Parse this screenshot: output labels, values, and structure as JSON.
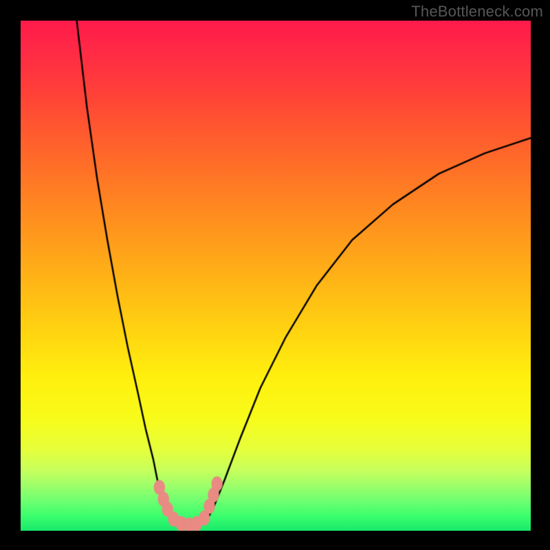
{
  "watermark": {
    "text": "TheBottleneck.com"
  },
  "colors": {
    "background": "#000000",
    "curve_stroke": "#000000",
    "marker_fill": "#e98a83",
    "gradient_stops": [
      "#ff1a4a",
      "#ff5a2e",
      "#ffa519",
      "#fff00e",
      "#c8ff5a",
      "#18e86a"
    ]
  },
  "chart_data": {
    "type": "line",
    "title": "",
    "xlabel": "",
    "ylabel": "",
    "xlim": [
      0,
      100
    ],
    "ylim": [
      0,
      100
    ],
    "grid": false,
    "series": [
      {
        "name": "left-branch",
        "x": [
          11,
          13,
          15,
          17,
          19,
          21,
          23,
          24.5,
          26,
          27,
          28.5,
          30
        ],
        "y": [
          100,
          83,
          69,
          57,
          46,
          36,
          27,
          20,
          14,
          9,
          5,
          2
        ]
      },
      {
        "name": "valley-floor",
        "x": [
          30,
          31,
          32,
          33,
          34,
          35,
          36.5
        ],
        "y": [
          2,
          1.3,
          1.0,
          0.9,
          1.0,
          1.3,
          2
        ]
      },
      {
        "name": "right-branch",
        "x": [
          36.5,
          38,
          40,
          43,
          47,
          52,
          58,
          65,
          73,
          82,
          91,
          100
        ],
        "y": [
          2,
          5,
          10,
          18,
          28,
          38,
          48,
          57,
          64,
          70,
          74,
          77
        ]
      }
    ],
    "markers": {
      "name": "valley-markers",
      "points": [
        {
          "x": 27.2,
          "y": 8.5
        },
        {
          "x": 28.0,
          "y": 6.2
        },
        {
          "x": 28.8,
          "y": 4.2
        },
        {
          "x": 30.0,
          "y": 2.3
        },
        {
          "x": 31.5,
          "y": 1.4
        },
        {
          "x": 33.0,
          "y": 1.1
        },
        {
          "x": 34.5,
          "y": 1.4
        },
        {
          "x": 36.0,
          "y": 2.5
        },
        {
          "x": 37.0,
          "y": 4.8
        },
        {
          "x": 37.8,
          "y": 7.0
        },
        {
          "x": 38.5,
          "y": 9.2
        }
      ]
    }
  }
}
